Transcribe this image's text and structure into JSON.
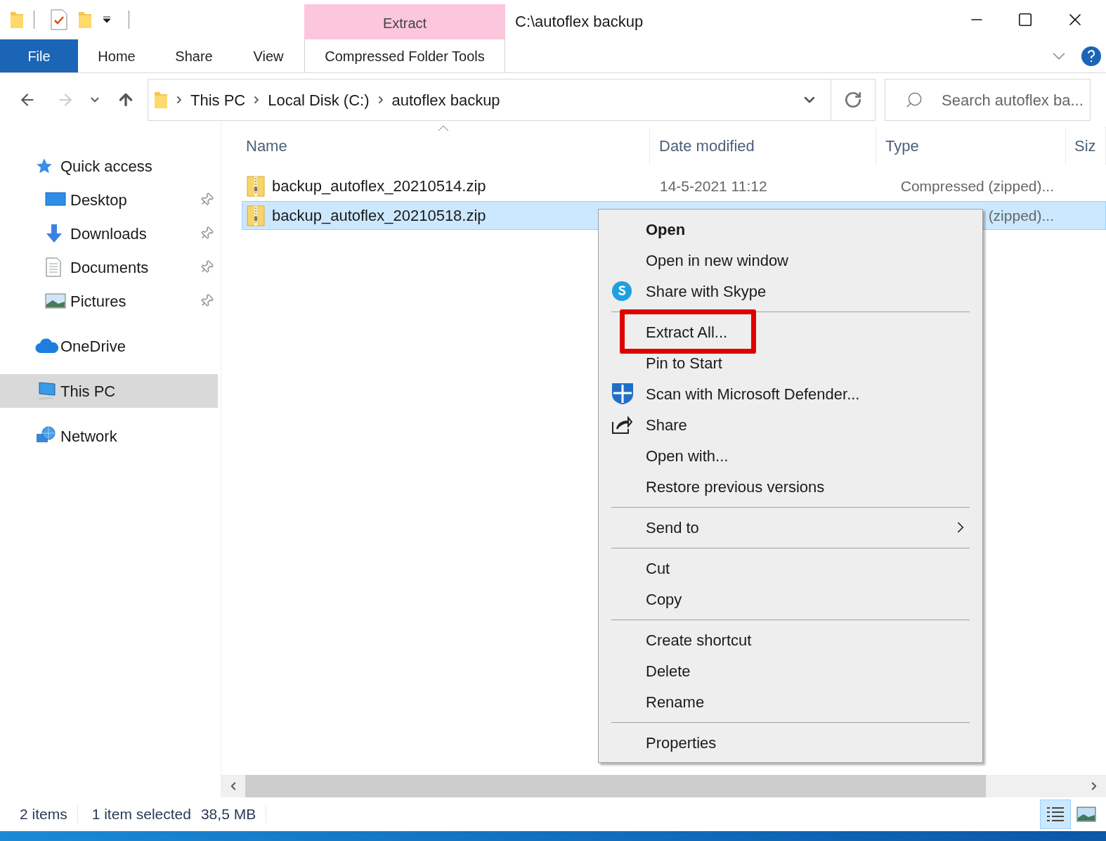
{
  "window": {
    "title": "C:\\autoflex backup",
    "context_tab": "Extract"
  },
  "ribbon_tabs": [
    {
      "label": "File",
      "kind": "file"
    },
    {
      "label": "Home",
      "kind": "tab"
    },
    {
      "label": "Share",
      "kind": "tab"
    },
    {
      "label": "View",
      "kind": "tab"
    },
    {
      "label": "Compressed Folder Tools",
      "kind": "context"
    }
  ],
  "address_bar": {
    "crumbs": [
      "This PC",
      "Local Disk (C:)",
      "autoflex backup"
    ]
  },
  "search": {
    "placeholder": "Search autoflex ba..."
  },
  "sidebar": {
    "items": [
      {
        "label": "Quick access",
        "kind": "star",
        "selected": false,
        "children": [
          {
            "label": "Desktop",
            "kind": "desktop",
            "selected": false,
            "pinned": true
          },
          {
            "label": "Downloads",
            "kind": "download",
            "selected": false,
            "pinned": true
          },
          {
            "label": "Documents",
            "kind": "document",
            "selected": false,
            "pinned": true
          },
          {
            "label": "Pictures",
            "kind": "picture",
            "selected": false,
            "pinned": true
          }
        ]
      },
      {
        "label": "OneDrive",
        "kind": "cloud",
        "selected": false
      },
      {
        "label": "This PC",
        "kind": "pc",
        "selected": true
      },
      {
        "label": "Network",
        "kind": "network",
        "selected": false
      }
    ]
  },
  "table": {
    "columns": [
      "Name",
      "Date modified",
      "Type",
      "Siz"
    ],
    "rows": [
      {
        "name": "backup_autoflex_20210514.zip",
        "date": "14-5-2021 11:12",
        "type": "Compressed (zipped)...",
        "selected": false
      },
      {
        "name": "backup_autoflex_20210518.zip",
        "type": "(zipped)...",
        "selected": true
      }
    ]
  },
  "context_menu": {
    "items": [
      {
        "kind": "item",
        "label": "Open",
        "default": true,
        "highlighted": false
      },
      {
        "kind": "item",
        "label": "Open in new window",
        "default": false,
        "highlighted": false
      },
      {
        "kind": "skype",
        "label": "Share with Skype",
        "default": false,
        "highlighted": false
      },
      {
        "kind": "separator"
      },
      {
        "kind": "item",
        "label": "Extract All...",
        "default": false,
        "highlighted": true
      },
      {
        "kind": "item",
        "label": "Pin to Start",
        "default": false,
        "highlighted": false
      },
      {
        "kind": "defender",
        "label": "Scan with Microsoft Defender...",
        "default": false,
        "highlighted": false
      },
      {
        "kind": "share",
        "label": "Share",
        "default": false,
        "highlighted": false
      },
      {
        "kind": "item",
        "label": "Open with...",
        "default": false,
        "highlighted": false
      },
      {
        "kind": "item",
        "label": "Restore previous versions",
        "default": false,
        "highlighted": false
      },
      {
        "kind": "separator"
      },
      {
        "kind": "submenu",
        "label": "Send to",
        "default": false,
        "highlighted": false
      },
      {
        "kind": "separator"
      },
      {
        "kind": "item",
        "label": "Cut",
        "default": false,
        "highlighted": false
      },
      {
        "kind": "item",
        "label": "Copy",
        "default": false,
        "highlighted": false
      },
      {
        "kind": "separator"
      },
      {
        "kind": "item",
        "label": "Create shortcut",
        "default": false,
        "highlighted": false
      },
      {
        "kind": "item",
        "label": "Delete",
        "default": false,
        "highlighted": false
      },
      {
        "kind": "item",
        "label": "Rename",
        "default": false,
        "highlighted": false
      },
      {
        "kind": "separator"
      },
      {
        "kind": "item",
        "label": "Properties",
        "default": false,
        "highlighted": false
      }
    ]
  },
  "status_bar": {
    "items": [
      "2 items",
      "1 item selected",
      "38,5 MB"
    ],
    "views": [
      {
        "kind": "details",
        "selected": true
      },
      {
        "kind": "large",
        "selected": false
      }
    ]
  }
}
